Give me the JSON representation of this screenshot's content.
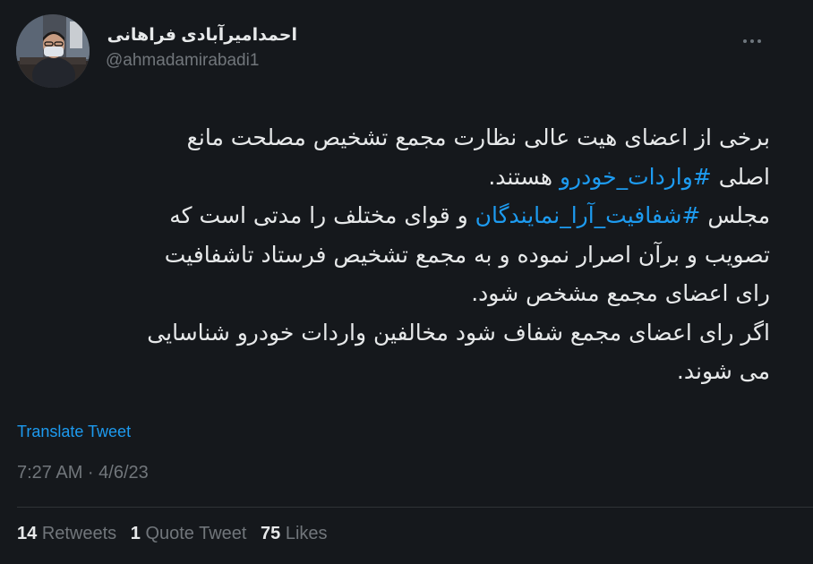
{
  "tweet": {
    "author_name": "احمدامیرآبادی فراهانی",
    "author_handle": "@ahmadamirabadi1",
    "body_lines": [
      [
        {
          "t": "برخی از اعضای هیت عالی نظارت مجمع تشخیص مصلحت مانع"
        }
      ],
      [
        {
          "t": "اصلی "
        },
        {
          "t": "#واردات_خودرو",
          "tag": true
        },
        {
          "t": " هستند."
        }
      ],
      [
        {
          "t": "مجلس "
        },
        {
          "t": "#شفافیت_آرا_نمایندگان",
          "tag": true
        },
        {
          "t": " و قوای مختلف را مدتی است که"
        }
      ],
      [
        {
          "t": "تصویب و برآن اصرار نموده و به مجمع تشخیص فرستاد تاشفافیت"
        }
      ],
      [
        {
          "t": "رای اعضای مجمع مشخص شود."
        }
      ],
      [
        {
          "t": "اگر رای اعضای مجمع شفاف شود مخالفین واردات خودرو شناسایی"
        }
      ],
      [
        {
          "t": "می شوند."
        }
      ]
    ],
    "translate_label": "Translate Tweet",
    "timestamp": "7:27 AM · 4/6/23",
    "stats": {
      "retweets_count": "14",
      "retweets_label": "Retweets",
      "quotes_count": "1",
      "quotes_label": "Quote Tweet",
      "likes_count": "75",
      "likes_label": "Likes"
    }
  },
  "colors": {
    "background": "#15181c",
    "text": "#e7e9ea",
    "secondary": "#71767b",
    "accent": "#1d9bf0",
    "divider": "#2f3336"
  },
  "icons": {
    "more": "more-horizontal-icon",
    "avatar": "profile-photo"
  }
}
